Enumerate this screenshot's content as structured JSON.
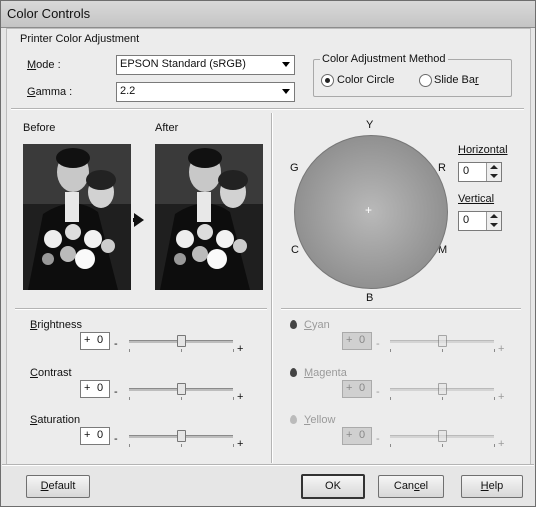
{
  "window": {
    "title": "Color Controls"
  },
  "printer_adjustment": {
    "title": "Printer Color Adjustment",
    "mode": {
      "label_pre": "M",
      "label_rest": "ode :",
      "value": "EPSON Standard (sRGB)"
    },
    "gamma": {
      "label_pre": "G",
      "label_rest": "amma :",
      "value": "2.2"
    }
  },
  "method": {
    "title": "Color Adjustment Method",
    "options": [
      {
        "label": "Color Circle",
        "selected": true
      },
      {
        "label_pre": "Slide Ba",
        "label_u": "r",
        "selected": false
      }
    ]
  },
  "preview": {
    "before": "Before",
    "after": "After"
  },
  "color_circle": {
    "labels": {
      "top": "Y",
      "right_upper": "R",
      "right_lower": "M",
      "bottom": "B",
      "left_lower": "C",
      "left_upper": "G"
    },
    "horizontal": {
      "label": "Horizontal",
      "value": "0"
    },
    "vertical": {
      "label": "Vertical",
      "value": "0"
    }
  },
  "sliders_left": [
    {
      "label_u": "B",
      "label_rest": "rightness",
      "sign": "+",
      "value": "0",
      "level": 0.5
    },
    {
      "label_u": "C",
      "label_rest": "ontrast",
      "sign": "+",
      "value": "0",
      "level": 0.5
    },
    {
      "label_u": "S",
      "label_rest": "aturation",
      "sign": "+",
      "value": "0",
      "level": 0.5
    }
  ],
  "sliders_right": [
    {
      "label_u": "C",
      "label_rest": "yan",
      "sign": "+",
      "value": "0",
      "level": 0.5
    },
    {
      "label_u": "M",
      "label_rest": "agenta",
      "sign": "+",
      "value": "0",
      "level": 0.5
    },
    {
      "label_u": "Y",
      "label_rest": "ellow",
      "sign": "+",
      "value": "0",
      "level": 0.5
    }
  ],
  "scale": {
    "minus": "-",
    "plus": "+"
  },
  "buttons": {
    "default": {
      "u": "D",
      "rest": "efault"
    },
    "ok": "OK",
    "cancel": {
      "pre": "Can",
      "u": "c",
      "rest": "el"
    },
    "help": {
      "u": "H",
      "rest": "elp"
    }
  }
}
